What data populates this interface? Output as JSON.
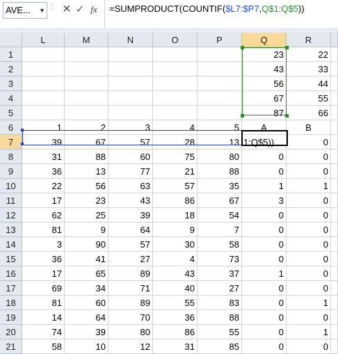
{
  "formula_bar": {
    "name_box": "AVE...",
    "cancel_glyph": "✕",
    "enter_glyph": "✓",
    "fx_label": "fx",
    "formula_parts": [
      "=SUMPRODUCT(COUNTIF(",
      "$L7:$P7",
      ",",
      "Q$1:Q$5",
      "))"
    ]
  },
  "columns": [
    "L",
    "M",
    "N",
    "O",
    "P",
    "Q",
    "R"
  ],
  "rows": [
    {
      "n": "1",
      "cells": [
        "",
        "",
        "",
        "",
        "",
        "23",
        "22"
      ]
    },
    {
      "n": "2",
      "cells": [
        "",
        "",
        "",
        "",
        "",
        "43",
        "33"
      ]
    },
    {
      "n": "3",
      "cells": [
        "",
        "",
        "",
        "",
        "",
        "56",
        "44"
      ]
    },
    {
      "n": "4",
      "cells": [
        "",
        "",
        "",
        "",
        "",
        "67",
        "55"
      ]
    },
    {
      "n": "5",
      "cells": [
        "",
        "",
        "",
        "",
        "",
        "87",
        "66"
      ]
    },
    {
      "n": "6",
      "cells": [
        "1",
        "2",
        "3",
        "4",
        "5",
        "A",
        "B"
      ]
    },
    {
      "n": "7",
      "cells": [
        "39",
        "67",
        "57",
        "28",
        "13",
        "1:Q$5))",
        "0"
      ]
    },
    {
      "n": "8",
      "cells": [
        "31",
        "88",
        "60",
        "75",
        "80",
        "0",
        "0"
      ]
    },
    {
      "n": "9",
      "cells": [
        "36",
        "13",
        "77",
        "21",
        "88",
        "0",
        "0"
      ]
    },
    {
      "n": "10",
      "cells": [
        "22",
        "56",
        "63",
        "57",
        "35",
        "1",
        "1"
      ]
    },
    {
      "n": "11",
      "cells": [
        "17",
        "23",
        "43",
        "86",
        "67",
        "3",
        "0"
      ]
    },
    {
      "n": "12",
      "cells": [
        "62",
        "25",
        "39",
        "18",
        "54",
        "0",
        "0"
      ]
    },
    {
      "n": "13",
      "cells": [
        "81",
        "9",
        "64",
        "9",
        "7",
        "0",
        "0"
      ]
    },
    {
      "n": "14",
      "cells": [
        "3",
        "90",
        "57",
        "30",
        "58",
        "0",
        "0"
      ]
    },
    {
      "n": "15",
      "cells": [
        "36",
        "41",
        "27",
        "4",
        "73",
        "0",
        "0"
      ]
    },
    {
      "n": "16",
      "cells": [
        "17",
        "65",
        "89",
        "43",
        "37",
        "1",
        "0"
      ]
    },
    {
      "n": "17",
      "cells": [
        "69",
        "34",
        "71",
        "40",
        "27",
        "0",
        "0"
      ]
    },
    {
      "n": "18",
      "cells": [
        "81",
        "60",
        "89",
        "55",
        "83",
        "0",
        "1"
      ]
    },
    {
      "n": "19",
      "cells": [
        "14",
        "64",
        "70",
        "36",
        "88",
        "0",
        "0"
      ]
    },
    {
      "n": "20",
      "cells": [
        "74",
        "39",
        "80",
        "86",
        "55",
        "0",
        "1"
      ]
    },
    {
      "n": "21",
      "cells": [
        "58",
        "10",
        "12",
        "31",
        "85",
        "0",
        "0"
      ]
    }
  ],
  "colors": {
    "selection_green": "#2e8b2e",
    "range_blue": "#1f3fbf",
    "header_selected": "#f9d99a"
  }
}
